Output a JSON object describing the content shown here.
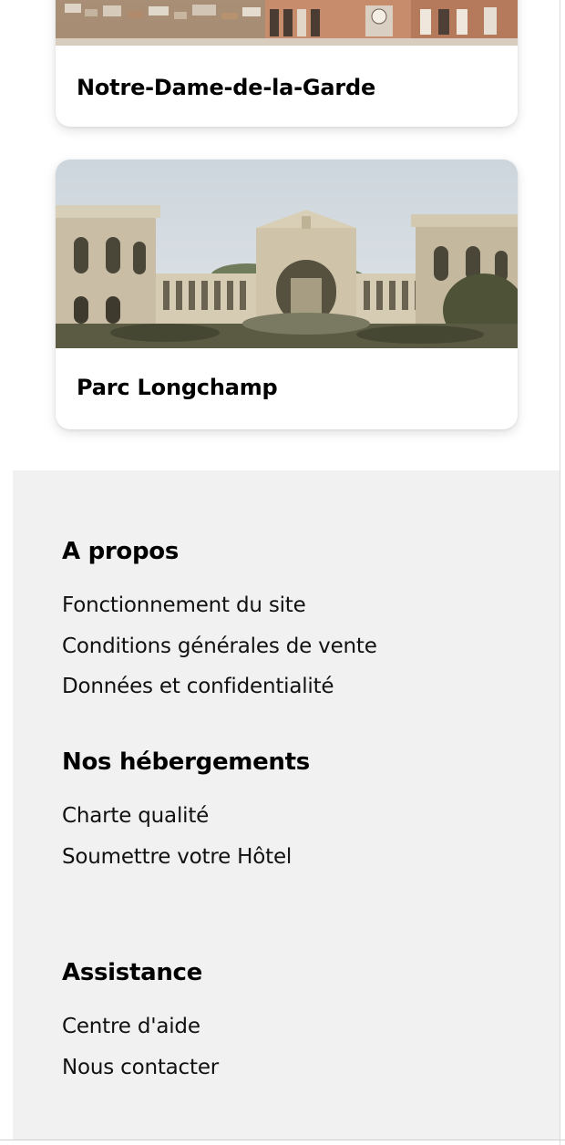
{
  "attractions": [
    {
      "title": "Notre-Dame-de-la-Garde",
      "image": "marseille-rooftops-photo"
    },
    {
      "title": "Parc Longchamp",
      "image": "palais-longchamp-photo"
    }
  ],
  "footer": {
    "sections": [
      {
        "heading": "A propos",
        "links": [
          "Fonctionnement du site",
          "Conditions générales de vente",
          "Données et confidentialité"
        ]
      },
      {
        "heading": "Nos hébergements",
        "links": [
          "Charte qualité",
          "Soumettre votre Hôtel"
        ]
      },
      {
        "heading": "Assistance",
        "links": [
          "Centre d'aide",
          "Nous contacter"
        ]
      }
    ]
  }
}
